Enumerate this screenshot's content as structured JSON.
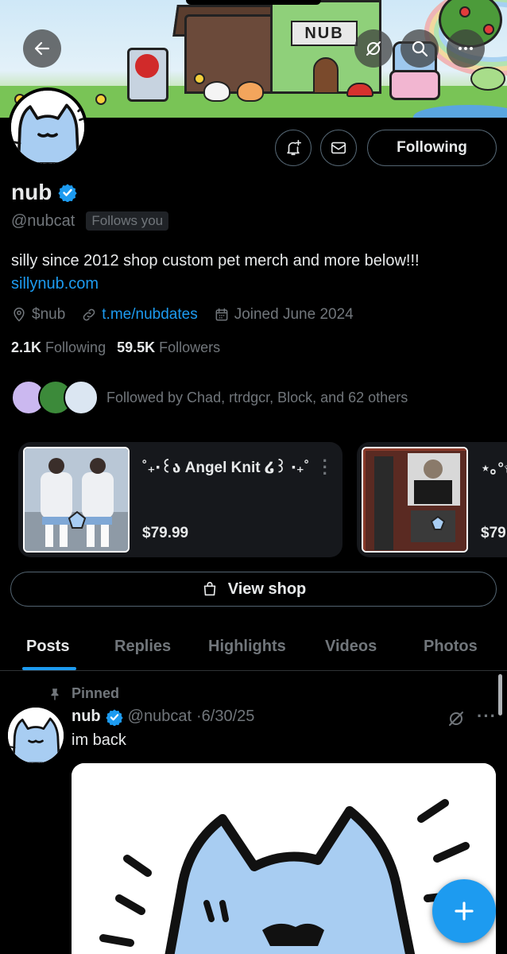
{
  "profile": {
    "name": "nub",
    "handle": "@nubcat",
    "follows_you": "Follows you",
    "bio": "silly since 2012 shop custom pet merch and more below!!!",
    "bio_link": "sillynub.com",
    "cashtag": "$nub",
    "link": "t.me/nubdates",
    "joined": "Joined June 2024",
    "following_count": "2.1K",
    "following_label": "Following",
    "followers_count": "59.5K",
    "followers_label": "Followers",
    "followed_by": "Followed by Chad, rtrdgcr, Block, and 62 others"
  },
  "banner": {
    "sign": "NUB"
  },
  "header_buttons": {
    "back": "back-arrow-icon",
    "grok": "grok-icon",
    "search": "search-icon",
    "more": "more-icon"
  },
  "actions": {
    "notify_icon": "bell-plus-icon",
    "message_icon": "envelope-icon",
    "following_label": "Following"
  },
  "shop": {
    "items": [
      {
        "title": "˚₊‧꒰ა Angel Knit ໒꒱ ‧₊˚",
        "price": "$79.99"
      },
      {
        "title": "⋆｡°✩",
        "price": "$79"
      }
    ],
    "view_shop_label": "View shop"
  },
  "tabs": [
    "Posts",
    "Replies",
    "Highlights",
    "Videos",
    "Photos"
  ],
  "active_tab": "Posts",
  "post": {
    "pinned_label": "Pinned",
    "author_name": "nub",
    "author_handle": "@nubcat",
    "date": "·6/30/25",
    "text": "im back"
  },
  "colors": {
    "accent": "#1d9bf0",
    "background": "#000000",
    "muted_text": "#71767b",
    "border": "#536471",
    "avatar_cat": "#a8cdf2"
  }
}
